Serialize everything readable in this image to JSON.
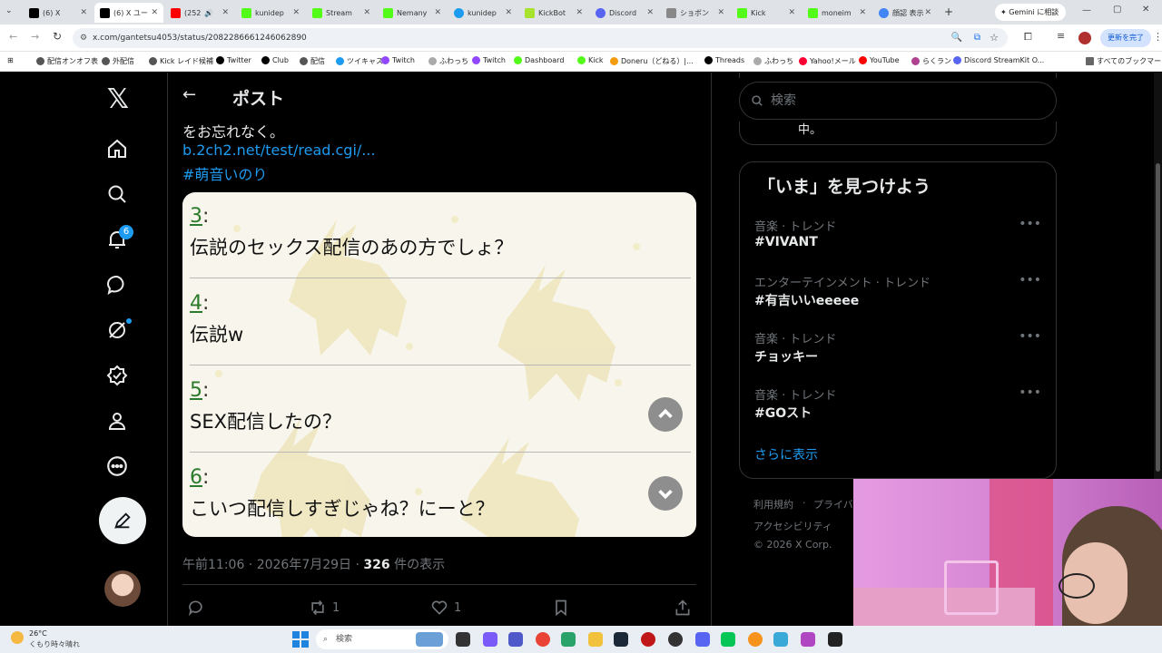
{
  "browser": {
    "tabs": [
      {
        "label": "(6) X",
        "color": "#000000"
      },
      {
        "label": "(6) X ユー",
        "color": "#000000"
      },
      {
        "label": "(252",
        "color": "#ff0000"
      },
      {
        "label": "kunidep",
        "color": "#53fc18"
      },
      {
        "label": "Stream",
        "color": "#53fc18"
      },
      {
        "label": "Nemany",
        "color": "#53fc18"
      },
      {
        "label": "kunidep",
        "color": "#1d9bf0"
      },
      {
        "label": "KickBot",
        "color": "#a6e22e"
      },
      {
        "label": "Discord",
        "color": "#5865f2"
      },
      {
        "label": "ショボン",
        "color": "#888888"
      },
      {
        "label": "Kick",
        "color": "#53fc18"
      },
      {
        "label": "moneim",
        "color": "#53fc18"
      },
      {
        "label": "顔認 表示",
        "color": "#4285f4"
      }
    ],
    "gemini_label": "Gemini に相談",
    "url": "x.com/gantetsu4053/status/2082286661246062890",
    "update_label": "更新を完了",
    "bookmarks": [
      "配信オンオフ表",
      "外配信",
      "Kick レイド候補",
      "Twitter",
      "Club",
      "配信",
      "ツイキャス",
      "Twitch",
      "ふわっち",
      "Twitch",
      "Dashboard",
      "Kick",
      "Doneru（どねる）|...",
      "Threads",
      "ふわっち",
      "Yahoo!メール",
      "YouTube",
      "らくラン",
      "Discord StreamKit O...",
      "すべてのブックマーク"
    ]
  },
  "nav": {
    "notification_count": "6"
  },
  "post": {
    "header_title": "ポスト",
    "text_tail": "をお忘れなく。",
    "link": "b.2ch2.net/test/read.cgi/...",
    "hashtag": "#萌音いのり",
    "card_posts": [
      {
        "num": "3",
        "body": "伝説のセックス配信のあの方でしょ？"
      },
      {
        "num": "4",
        "body": "伝説w"
      },
      {
        "num": "5",
        "body": "SEX配信したの？"
      },
      {
        "num": "6",
        "body": "こいつ配信しすぎじゃね？にーと？"
      }
    ],
    "timestamp": "午前11:06 · 2026年7月29日 · ",
    "views_count": "326",
    "views_label": " 件の表示",
    "retweet_count": "1",
    "like_count": "1"
  },
  "sidebar": {
    "search_placeholder": "検索",
    "prev_snippet": "中。",
    "trends_title": "「いま」を見つけよう",
    "trends": [
      {
        "category": "音楽 · トレンド",
        "name": "#VIVANT"
      },
      {
        "category": "エンターテインメント · トレンド",
        "name": "#有吉いいeeeee"
      },
      {
        "category": "音楽 · トレンド",
        "name": "チョッキー"
      },
      {
        "category": "音楽 · トレンド",
        "name": "#GOスト"
      }
    ],
    "show_more": "さらに表示",
    "footer": [
      "利用規約",
      "プライバ",
      "アクセシビリティ",
      "© 2026 X Corp."
    ]
  },
  "taskbar": {
    "weather_temp": "26°C",
    "weather_desc": "くもり時々晴れ",
    "search_label": "検索"
  }
}
